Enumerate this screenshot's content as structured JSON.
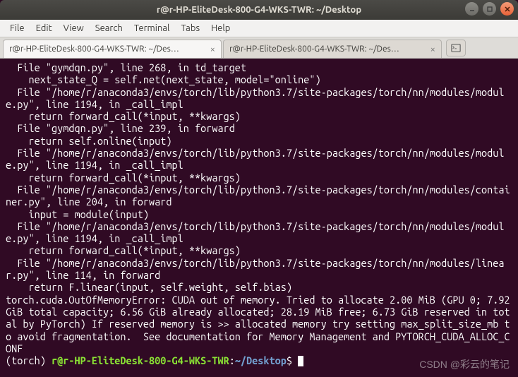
{
  "window": {
    "title": "r@r-HP-EliteDesk-800-G4-WKS-TWR: ~/Desktop"
  },
  "menu": {
    "file": "File",
    "edit": "Edit",
    "view": "View",
    "search": "Search",
    "terminal": "Terminal",
    "tabs": "Tabs",
    "help": "Help"
  },
  "tabs": {
    "tab0": "r@r-HP-EliteDesk-800-G4-WKS-TWR: ~/Des…",
    "tab1": "r@r-HP-EliteDesk-800-G4-WKS-TWR: ~/Des…"
  },
  "terminal": {
    "output": "  File \"gymdqn.py\", line 268, in td_target\n    next_state_Q = self.net(next_state, model=\"online\")\n  File \"/home/r/anaconda3/envs/torch/lib/python3.7/site-packages/torch/nn/modules/module.py\", line 1194, in _call_impl\n    return forward_call(*input, **kwargs)\n  File \"gymdqn.py\", line 239, in forward\n    return self.online(input)\n  File \"/home/r/anaconda3/envs/torch/lib/python3.7/site-packages/torch/nn/modules/module.py\", line 1194, in _call_impl\n    return forward_call(*input, **kwargs)\n  File \"/home/r/anaconda3/envs/torch/lib/python3.7/site-packages/torch/nn/modules/container.py\", line 204, in forward\n    input = module(input)\n  File \"/home/r/anaconda3/envs/torch/lib/python3.7/site-packages/torch/nn/modules/module.py\", line 1194, in _call_impl\n    return forward_call(*input, **kwargs)\n  File \"/home/r/anaconda3/envs/torch/lib/python3.7/site-packages/torch/nn/modules/linear.py\", line 114, in forward\n    return F.linear(input, self.weight, self.bias)\ntorch.cuda.OutOfMemoryError: CUDA out of memory. Tried to allocate 2.00 MiB (GPU 0; 7.92 GiB total capacity; 6.56 GiB already allocated; 28.19 MiB free; 6.73 GiB reserved in total by PyTorch) If reserved memory is >> allocated memory try setting max_split_size_mb to avoid fragmentation.  See documentation for Memory Management and PYTORCH_CUDA_ALLOC_CONF",
    "prompt": {
      "env": "(torch) ",
      "userhost": "r@r-HP-EliteDesk-800-G4-WKS-TWR",
      "colon": ":",
      "path": "~/Desktop",
      "dollar": "$ "
    }
  },
  "watermark": "CSDN @彩云的笔记"
}
